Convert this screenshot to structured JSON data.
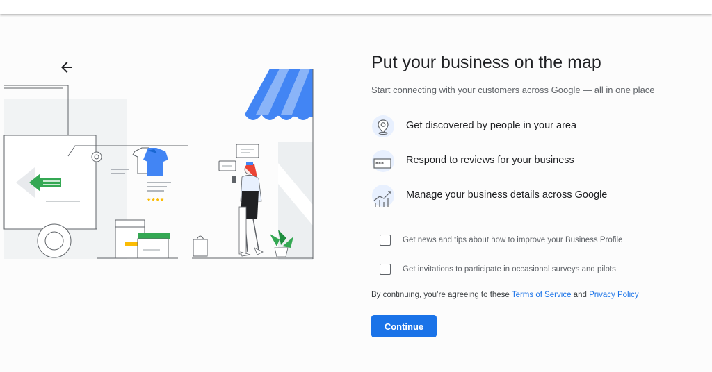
{
  "page": {
    "title": "Put your business on the map",
    "subtitle": "Start connecting with your customers across Google — all in one place"
  },
  "features": [
    {
      "icon": "location-pin-icon",
      "label": "Get discovered by people in your area"
    },
    {
      "icon": "reviews-icon",
      "label": "Respond to reviews for your business"
    },
    {
      "icon": "business-chart-icon",
      "label": "Manage your business details across Google"
    }
  ],
  "checkboxes": [
    {
      "label": "Get news and tips about how to improve your Business Profile",
      "checked": false
    },
    {
      "label": "Get invitations to participate in occasional surveys and pilots",
      "checked": false
    }
  ],
  "agreement": {
    "prefix": "By continuing, you’re agreeing to these",
    "terms_link": "Terms of Service",
    "and": "and",
    "privacy_link": "Privacy Policy"
  },
  "continue_button": "Continue",
  "icons": {
    "back": "arrow-back-icon"
  },
  "colors": {
    "accent": "#1a73e8",
    "awning_blue": "#4285f4",
    "awning_light": "#8ab4f8",
    "green": "#34a853",
    "yellow": "#fbbc04",
    "red": "#ea4335"
  }
}
